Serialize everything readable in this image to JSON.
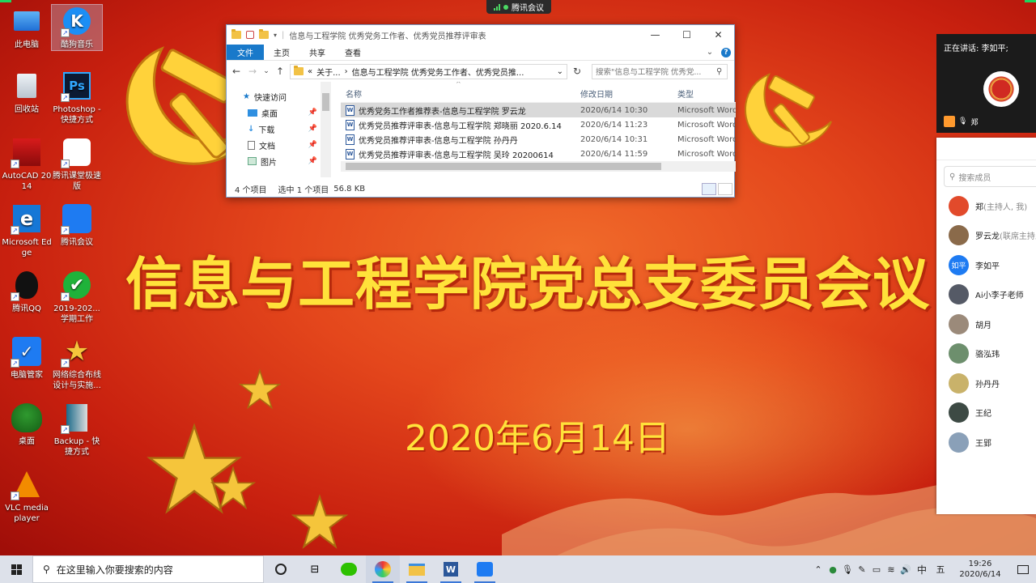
{
  "meeting_bar": {
    "app_name": "腾讯会议"
  },
  "wallpaper": {
    "title": "信息与工程学院党总支委员会议",
    "date": "2020年6月14日"
  },
  "desktop_icons": [
    {
      "label": "此电脑",
      "icon": "computer-icon"
    },
    {
      "label": "酷狗音乐",
      "icon": "kugou-icon"
    },
    {
      "label": "回收站",
      "icon": "recycle-bin-icon"
    },
    {
      "label": "Photoshop - 快捷方式",
      "icon": "photoshop-icon"
    },
    {
      "label": "AutoCAD 2014",
      "icon": "autocad-icon"
    },
    {
      "label": "腾讯课堂极速版",
      "icon": "tencent-classroom-icon"
    },
    {
      "label": "Microsoft Edge",
      "icon": "edge-icon"
    },
    {
      "label": "腾讯会议",
      "icon": "tencent-meeting-icon"
    },
    {
      "label": "腾讯QQ",
      "icon": "qq-icon"
    },
    {
      "label": "2019-202... 学期工作",
      "icon": "folder-check-icon"
    },
    {
      "label": "电脑管家",
      "icon": "pc-manager-icon"
    },
    {
      "label": "网络综合布线设计与实施...",
      "icon": "star-file-icon"
    },
    {
      "label": "桌面",
      "icon": "tree-icon"
    },
    {
      "label": "Backup - 快捷方式",
      "icon": "backup-icon"
    },
    {
      "label": "VLC media player",
      "icon": "vlc-icon"
    }
  ],
  "explorer": {
    "title": "信息与工程学院 优秀党务工作者、优秀党员推荐评审表",
    "ribbon_tabs": [
      "文件",
      "主页",
      "共享",
      "查看"
    ],
    "address_parts": [
      "«",
      "关于...",
      "›",
      "信息与工程学院 优秀党务工作者、优秀党员推..."
    ],
    "search_placeholder": "搜索\"信息与工程学院 优秀党...",
    "nav": {
      "quick_access": "快速访问",
      "items": [
        "桌面",
        "下载",
        "文档",
        "图片"
      ]
    },
    "columns": [
      "名称",
      "修改日期",
      "类型"
    ],
    "files": [
      {
        "name": "优秀党务工作者推荐表-信息与工程学院 罗云龙",
        "date": "2020/6/14 10:30",
        "type": "Microsoft Word"
      },
      {
        "name": "优秀党员推荐评审表-信息与工程学院 郑晓丽 2020.6.14",
        "date": "2020/6/14 11:23",
        "type": "Microsoft Word"
      },
      {
        "name": "优秀党员推荐评审表-信息与工程学院 孙丹丹",
        "date": "2020/6/14 10:31",
        "type": "Microsoft Word"
      },
      {
        "name": "优秀党员推荐评审表-信息与工程学院 吴玲 20200614",
        "date": "2020/6/14 11:59",
        "type": "Microsoft Word"
      }
    ],
    "status": {
      "count": "4 个项目",
      "selected": "选中 1 个项目",
      "size": "56.8 KB"
    }
  },
  "video": {
    "speaking": "正在讲话: 李如平;",
    "self_name": "郑"
  },
  "members": {
    "search_placeholder": "搜索成员",
    "list": [
      {
        "name": "郑",
        "role": "(主持人, 我)",
        "initials": "",
        "color": "#e24a2b"
      },
      {
        "name": "罗云龙",
        "role": "(联席主持人)",
        "initials": "",
        "color": "#8a6a4a"
      },
      {
        "name": "李如平",
        "role": "",
        "initials": "如平",
        "color": "#1e7bf2"
      },
      {
        "name": "Ai小李子老师",
        "role": "",
        "initials": "",
        "color": "#555a66"
      },
      {
        "name": "胡月",
        "role": "",
        "initials": "",
        "color": "#9b8a7a"
      },
      {
        "name": "骆泓玮",
        "role": "",
        "initials": "",
        "color": "#6d8f6d"
      },
      {
        "name": "孙丹丹",
        "role": "",
        "initials": "",
        "color": "#c9b26a"
      },
      {
        "name": "王纪",
        "role": "",
        "initials": "",
        "color": "#3d4a44"
      },
      {
        "name": "王郢",
        "role": "",
        "initials": "",
        "color": "#8aa0b8"
      }
    ]
  },
  "taskbar": {
    "search_placeholder": "在这里输入你要搜索的内容",
    "ime": "中",
    "ime_mode": "五",
    "time": "19:26",
    "date": "2020/6/14"
  }
}
